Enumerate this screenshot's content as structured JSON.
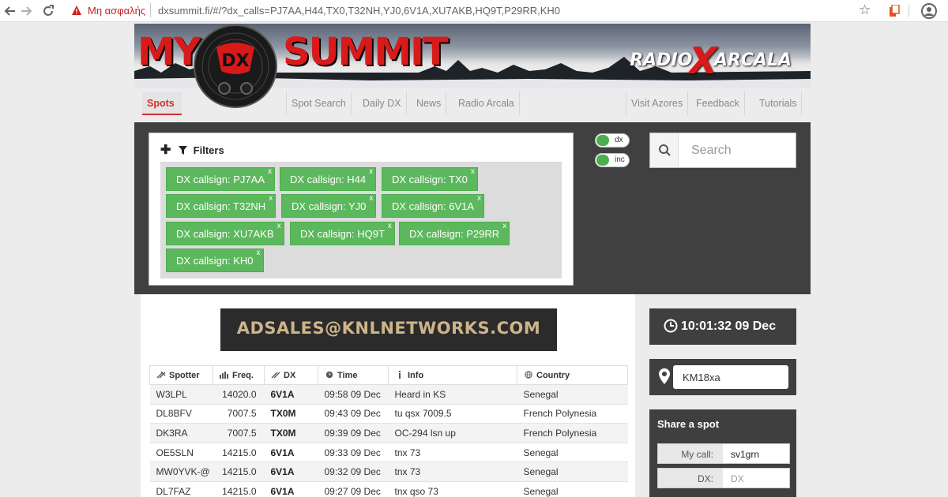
{
  "browser": {
    "insecure_label": "Μη ασφαλής",
    "url": "dxsummit.fi/#/?dx_calls=PJ7AA,H44,TX0,T32NH,YJ0,6V1A,XU7AKB,HQ9T,P29RR,KH0",
    "icons": [
      "back-arrow-icon",
      "forward-arrow-icon",
      "reload-icon",
      "warning-icon",
      "star-icon",
      "extension-icon",
      "account-icon"
    ]
  },
  "header": {
    "logo_my": "MY",
    "logo_dx": "DX",
    "logo_summit": "SUMMIT",
    "radio_left": "RADIO",
    "radio_x": "X",
    "radio_right": "ARCALA"
  },
  "nav": {
    "tabs": [
      "Spots",
      "Spot Search",
      "Daily DX",
      "News",
      "Radio Arcala",
      "Visit Azores",
      "Feedback",
      "Tutorials"
    ]
  },
  "filters": {
    "title": "Filters",
    "chips": [
      "DX callsign: PJ7AA",
      "DX callsign: H44",
      "DX callsign: TX0",
      "DX callsign: T32NH",
      "DX callsign: YJ0",
      "DX callsign: 6V1A",
      "DX callsign: XU7AKB",
      "DX callsign: HQ9T",
      "DX callsign: P29RR",
      "DX callsign: KH0"
    ],
    "remove_glyph": "x"
  },
  "toggles": {
    "dx": "dx",
    "inc": "inc"
  },
  "search": {
    "placeholder": "Search"
  },
  "ad": {
    "text": "ADSALES@KNLNETWORKS.COM"
  },
  "table": {
    "headers": [
      "Spotter",
      "Freq.",
      "DX",
      "Time",
      "Info",
      "Country"
    ],
    "rows": [
      [
        "W3LPL",
        "14020.0",
        "6V1A",
        "09:58 09 Dec",
        "Heard in KS",
        "Senegal"
      ],
      [
        "DL8BFV",
        "7007.5",
        "TX0M",
        "09:43 09 Dec",
        "tu qsx 7009.5",
        "French Polynesia"
      ],
      [
        "DK3RA",
        "7007.5",
        "TX0M",
        "09:39 09 Dec",
        "OC-294 lsn up",
        "French Polynesia"
      ],
      [
        "OE5SLN",
        "14215.0",
        "6V1A",
        "09:33 09 Dec",
        "tnx 73",
        "Senegal"
      ],
      [
        "MW0YVK-@",
        "14215.0",
        "6V1A",
        "09:32 09 Dec",
        "tnx 73",
        "Senegal"
      ],
      [
        "DL7FAZ",
        "14215.0",
        "6V1A",
        "09:27 09 Dec",
        "tnx qso 73",
        "Senegal"
      ]
    ]
  },
  "sidebar": {
    "clock": "10:01:32 09 Dec",
    "locator": "KM18xa",
    "share_title": "Share a spot",
    "my_call_label": "My call:",
    "my_call_value": "sv1grn",
    "dx_label": "DX:",
    "dx_placeholder": "DX"
  }
}
